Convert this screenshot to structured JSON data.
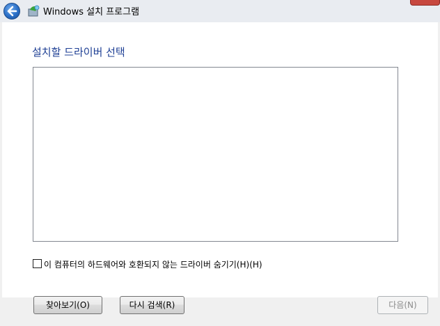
{
  "window": {
    "title": "Windows 설치 프로그램"
  },
  "main": {
    "heading": "설치할 드라이버 선택",
    "hide_incompatible_label": "이 컴퓨터의 하드웨어와 호환되지 않는 드라이버 숨기기(H)(H)",
    "hide_incompatible_checked": false
  },
  "buttons": {
    "browse": "찾아보기(O)",
    "rescan": "다시 검색(R)",
    "next": "다음(N)"
  },
  "colors": {
    "heading": "#1e3f94",
    "close_button": "#c7483f"
  },
  "icons": {
    "back": "back-arrow-icon",
    "app": "windows-setup-icon"
  }
}
